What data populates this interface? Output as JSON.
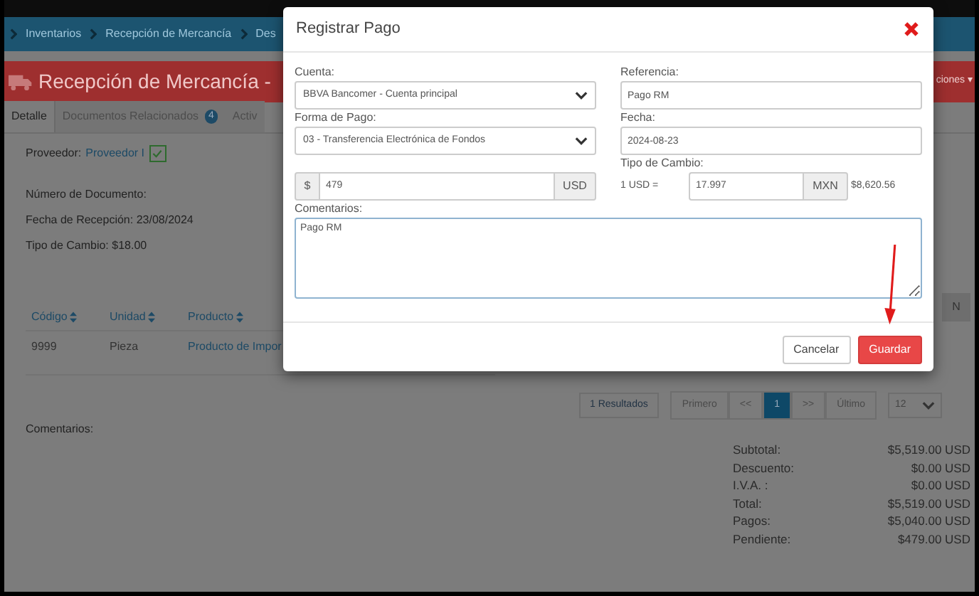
{
  "breadcrumbs": [
    {
      "label": "Inventarios"
    },
    {
      "label": "Recepción de Mercancía"
    },
    {
      "label": "Des"
    }
  ],
  "header": {
    "title": "Recepción de Mercancía -",
    "actions_button": "ciones ▾"
  },
  "tabs": [
    {
      "label": "Detalle",
      "selected": true
    },
    {
      "label": "Documentos Relacionados",
      "selected": false,
      "badge": "4"
    },
    {
      "label": "Activ",
      "selected": false
    }
  ],
  "details": {
    "supplier_label": "Proveedor:",
    "supplier_link": "Proveedor I",
    "supplier_checked": true,
    "lines": [
      "Número de Documento:",
      "Fecha de Recepción: 23/08/2024",
      "Tipo de Cambio: $18.00"
    ],
    "side_button": "N"
  },
  "table": {
    "columns": [
      "Código",
      "Unidad",
      "Producto"
    ],
    "rows": [
      [
        "9999",
        "Pieza",
        "Producto de Impor"
      ]
    ]
  },
  "pagination": {
    "results": "1 Resultados",
    "pages": [
      {
        "label": "Primero",
        "selected": false
      },
      {
        "label": "<<",
        "selected": false
      },
      {
        "label": "1",
        "selected": true
      },
      {
        "label": ">>",
        "selected": false
      },
      {
        "label": "Último",
        "selected": false
      }
    ],
    "page_size": "12"
  },
  "comments_label": "Comentarios:",
  "totals": [
    {
      "label": "Subtotal:",
      "value": "$5,519.00 USD"
    },
    {
      "label": "Descuento:",
      "value": "$0.00 USD"
    },
    {
      "label": "I.V.A. :",
      "value": "$0.00 USD"
    },
    {
      "label": "Total:",
      "value": "$5,519.00 USD"
    },
    {
      "label": "Pagos:",
      "value": "$5,040.00 USD"
    },
    {
      "label": "Pendiente:",
      "value": "$479.00 USD"
    }
  ],
  "modal": {
    "title": "Registrar Pago",
    "account": {
      "label": "Cuenta:",
      "value": "BBVA Bancomer - Cuenta principal"
    },
    "reference": {
      "label": "Referencia:",
      "value": "Pago RM"
    },
    "payment_method": {
      "label": "Forma de Pago:",
      "value": "03 - Transferencia Electrónica de Fondos"
    },
    "date": {
      "label": "Fecha:",
      "value": "2024-08-23"
    },
    "amount": {
      "prefix": "$",
      "value": "479",
      "suffix": "USD"
    },
    "exchange": {
      "label": "Tipo de Cambio:",
      "prefix": "1 USD =",
      "value": "17.997",
      "suffix": "MXN",
      "converted": "$8,620.56"
    },
    "comments": {
      "label": "Comentarios:",
      "value": "Pago RM"
    },
    "buttons": [
      {
        "label": "Cancelar",
        "kind": "secondary"
      },
      {
        "label": "Guardar",
        "kind": "primary"
      }
    ]
  }
}
